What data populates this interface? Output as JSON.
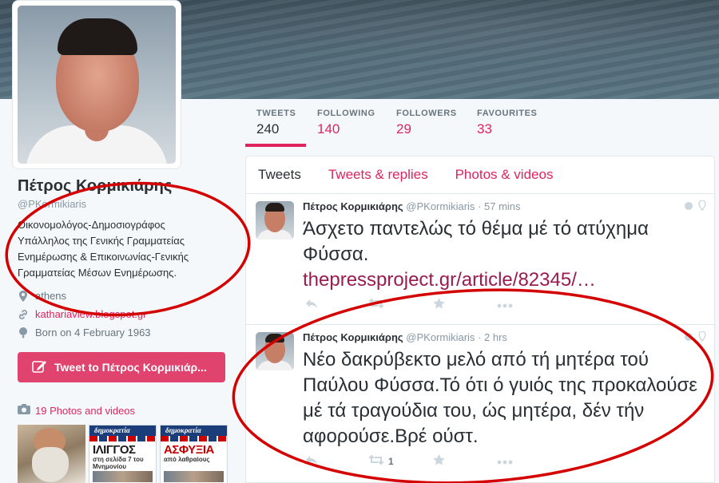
{
  "profile": {
    "name": "Πέτρος Κορμικιάρης",
    "handle": "@PKormikiaris",
    "bio_lines": [
      "Οικονομολόγος-Δημοσιογράφος",
      "Υπάλληλος της Γενικής Γραμματείας",
      "Ενημέρωσης & Επικοινωνίας-Γενικής",
      "Γραμματείας Μέσων Ενημέρωσης."
    ],
    "location": "athens",
    "website": "kathariaview.blogspot.gr",
    "born": "Born on 4 February 1963",
    "tweet_to_label": "Tweet to Πέτρος Κορμικιάρ...",
    "photos_label": "19 Photos and videos"
  },
  "stats": [
    {
      "label": "TWEETS",
      "value": "240"
    },
    {
      "label": "FOLLOWING",
      "value": "140"
    },
    {
      "label": "FOLLOWERS",
      "value": "29"
    },
    {
      "label": "FAVOURITES",
      "value": "33"
    }
  ],
  "timeline_tabs": [
    "Tweets",
    "Tweets & replies",
    "Photos & videos"
  ],
  "thumbnails": [
    {
      "kind": "photo"
    },
    {
      "kind": "newspaper",
      "masthead": "δημοκρατία",
      "headline": "ΙΛΙΓΓΟΣ",
      "sub": "στη σελίδα 7 του Μνημονίου"
    },
    {
      "kind": "newspaper",
      "masthead": "δημοκρατία",
      "headline": "ΑΣΦΥΞΙΑ",
      "sub": "από λαθραίους"
    }
  ],
  "tweets": [
    {
      "name": "Πέτρος Κορμικιάρης",
      "handle": "@PKormikiaris",
      "time": "· 57 mins",
      "text": "Άσχετο παντελώς τό θέμα μέ τό ατύχημα Φύσσα.",
      "link": "thepressproject.gr/article/82345/…",
      "retweets": ""
    },
    {
      "name": "Πέτρος Κορμικιάρης",
      "handle": "@PKormikiaris",
      "time": "· 2 hrs",
      "text": "Νέο δακρύβεκτο μελό από τή μητέρα τού Παύλου Φύσσα.Τό ότι ό γυιός της προκαλούσε μέ τά τραγούδια του, ώς μητέρα, δέν τήν αφορούσε.Βρέ ούστ.",
      "link": "",
      "retweets": "1"
    }
  ],
  "colors": {
    "accent": "#e0245e",
    "button": "#e0436e",
    "annotation": "#d40000"
  }
}
